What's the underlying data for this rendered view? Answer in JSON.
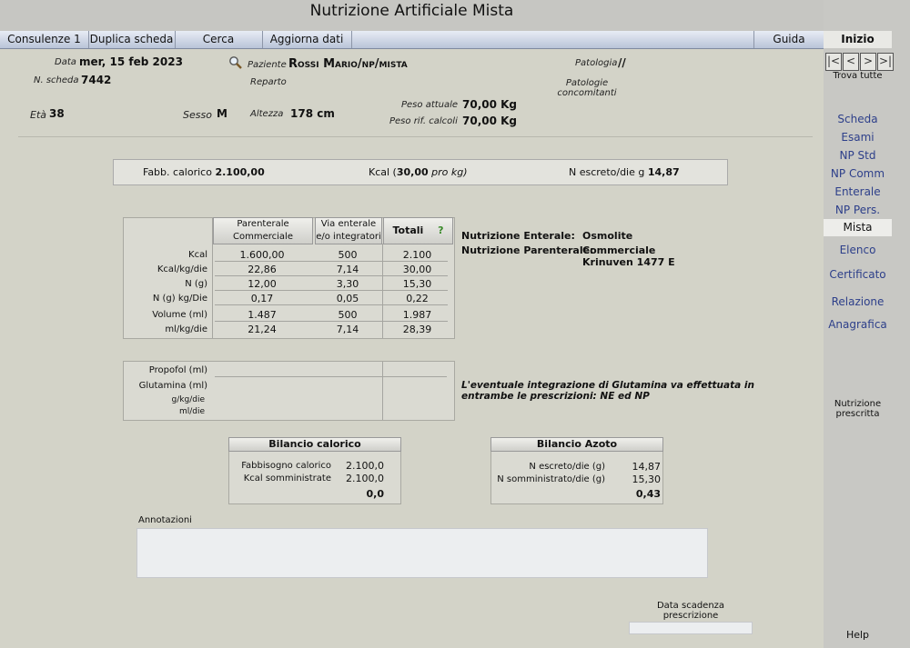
{
  "window": {
    "title": "Nutrizione Artificiale Mista"
  },
  "menu": {
    "consulenze": "Consulenze 1",
    "duplica": "Duplica scheda",
    "cerca": "Cerca",
    "aggiorna": "Aggiorna dati",
    "guida": "Guida",
    "inizio": "Inizio"
  },
  "patient": {
    "data_label": "Data",
    "data_value": "mer, 15 feb 2023",
    "paziente_label": "Paziente",
    "paziente_value": "Rossi Mario/np/mista",
    "patologia_label": "Patologia",
    "patologia_value": "//",
    "scheda_label": "N. scheda",
    "scheda_value": "7442",
    "reparto_label": "Reparto",
    "concomitanti_label": "Patologie concomitanti",
    "peso_label": "Peso attuale",
    "peso_value": "70,00 Kg",
    "peso_rif_label": "Peso rif. calcoli",
    "peso_rif_value": "70,00 Kg",
    "eta_label": "Età",
    "eta_value": "38",
    "sesso_label": "Sesso",
    "sesso_value": "M",
    "altezza_label": "Altezza",
    "altezza_value": "178 cm"
  },
  "fabbisogno": {
    "label": "Fabb. calorico",
    "value": "2.100,00",
    "kcal_label": "Kcal (",
    "kcal_value": "30,00",
    "kcal_unit": "pro kg)",
    "n_label": "N escreto/die g",
    "n_value": "14,87"
  },
  "table": {
    "headers": {
      "parenterale": "Parenterale Commerciale",
      "enterale": "Via enterale e/o integratori",
      "totali": "Totali",
      "help": "?"
    },
    "rows": [
      {
        "label": "Kcal",
        "par": "1.600,00",
        "ent": "500",
        "tot": "2.100"
      },
      {
        "label": "Kcal/kg/die",
        "par": "22,86",
        "ent": "7,14",
        "tot": "30,00"
      },
      {
        "label": "N  (g)",
        "par": "12,00",
        "ent": "3,30",
        "tot": "15,30"
      },
      {
        "label": "N (g)  kg/Die",
        "par": "0,17",
        "ent": "0,05",
        "tot": "0,22"
      },
      {
        "label": "Volume (ml)",
        "par": "1.487",
        "ent": "500",
        "tot": "1.987"
      },
      {
        "label": "ml/kg/die",
        "par": "21,24",
        "ent": "7,14",
        "tot": "28,39"
      }
    ]
  },
  "nutrizione": {
    "enterale_label": "Nutrizione Enterale:",
    "enterale_value": "Osmolite",
    "parenterale_label": "Nutrizione Parenterale:",
    "parenterale_value1": "Commerciale",
    "parenterale_value2": "Krinuven 1477 E"
  },
  "integrazione": {
    "propofol": "Propofol (ml)",
    "glutamina": "Glutamina (ml)",
    "gkg": "g/kg/die",
    "mldie": "ml/die",
    "note": "L'eventuale integrazione di Glutamina va effettuata in entrambe le prescrizioni: NE ed NP"
  },
  "bilancio_calorico": {
    "title": "Bilancio calorico",
    "fabb_label": "Fabbisogno calorico",
    "fabb_value": "2.100,0",
    "somm_label": "Kcal somministrate",
    "somm_value": "2.100,0",
    "diff": "0,0"
  },
  "bilancio_azoto": {
    "title": "Bilancio Azoto",
    "escreto_label": "N escreto/die (g)",
    "escreto_value": "14,87",
    "somm_label": "N somministrato/die (g)",
    "somm_value": "15,30",
    "diff": "0,43"
  },
  "annotazioni": {
    "label": "Annotazioni"
  },
  "scadenza": {
    "label": "Data scadenza prescrizione"
  },
  "sidebar": {
    "trova": "Trova tutte",
    "items": [
      "Scheda",
      "Esami",
      "NP Std",
      "NP Comm",
      "Enterale",
      "NP Pers.",
      "Mista",
      "Elenco",
      "Certificato",
      "Relazione",
      "Anagrafica"
    ],
    "prescritta": "Nutrizione prescritta",
    "help": "Help"
  }
}
